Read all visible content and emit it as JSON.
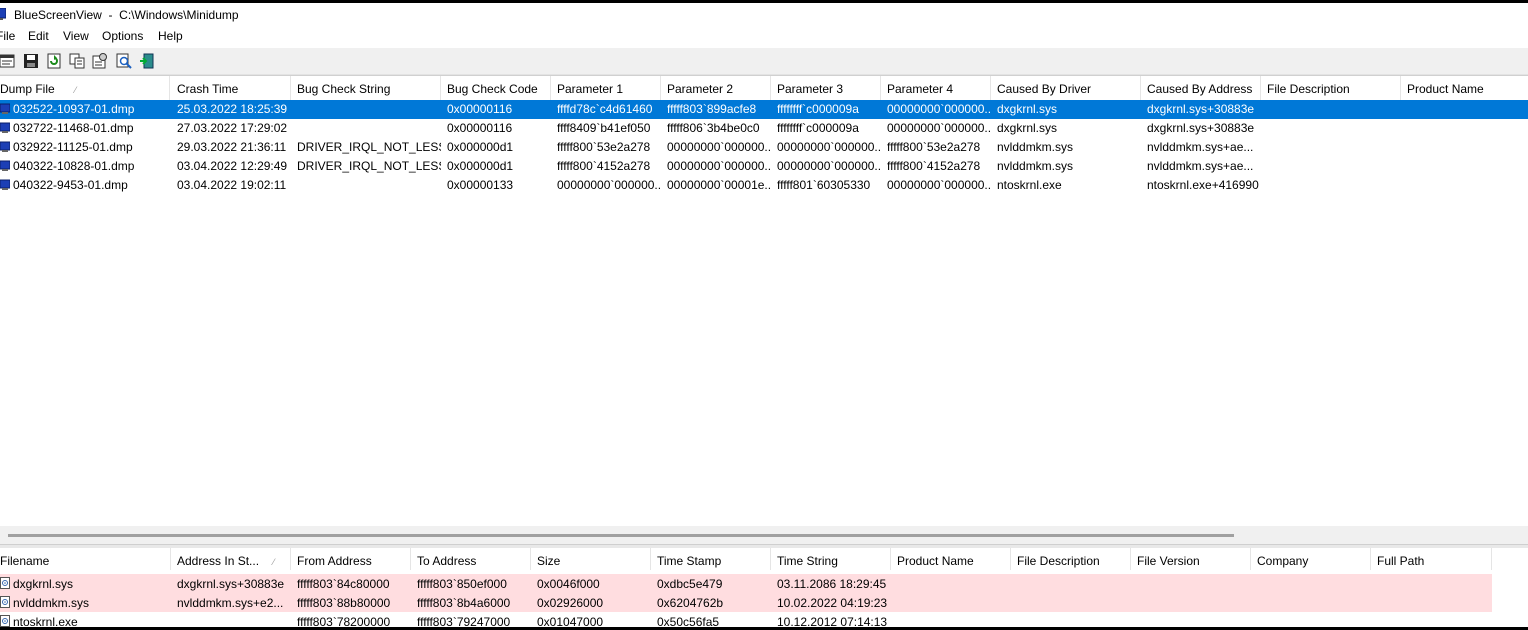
{
  "window": {
    "title": "BlueScreenView  -  C:\\Windows\\Minidump"
  },
  "menu": [
    "File",
    "Edit",
    "View",
    "Options",
    "Help"
  ],
  "toolbar": {
    "buttons": [
      "properties-icon",
      "save-icon",
      "refresh-icon",
      "copy-icon",
      "advanced-options-icon",
      "find-icon",
      "exit-icon"
    ]
  },
  "upper": {
    "columns": [
      "Dump File",
      "Crash Time",
      "Bug Check String",
      "Bug Check Code",
      "Parameter 1",
      "Parameter 2",
      "Parameter 3",
      "Parameter 4",
      "Caused By Driver",
      "Caused By Address",
      "File Description",
      "Product Name"
    ],
    "sort_indicator": "⁄",
    "rows": [
      [
        "032522-10937-01.dmp",
        "25.03.2022 18:25:39",
        "",
        "0x00000116",
        "ffffd78c`c4d61460",
        "fffff803`899acfe8",
        "ffffffff`c000009a",
        "00000000`000000...",
        "dxgkrnl.sys",
        "dxgkrnl.sys+30883e",
        "",
        ""
      ],
      [
        "032722-11468-01.dmp",
        "27.03.2022 17:29:02",
        "",
        "0x00000116",
        "ffff8409`b41ef050",
        "fffff806`3b4be0c0",
        "ffffffff`c000009a",
        "00000000`000000...",
        "dxgkrnl.sys",
        "dxgkrnl.sys+30883e",
        "",
        ""
      ],
      [
        "032922-11125-01.dmp",
        "29.03.2022 21:36:11",
        "DRIVER_IRQL_NOT_LESS...",
        "0x000000d1",
        "fffff800`53e2a278",
        "00000000`000000...",
        "00000000`000000...",
        "fffff800`53e2a278",
        "nvlddmkm.sys",
        "nvlddmkm.sys+ae...",
        "",
        ""
      ],
      [
        "040322-10828-01.dmp",
        "03.04.2022 12:29:49",
        "DRIVER_IRQL_NOT_LESS...",
        "0x000000d1",
        "fffff800`4152a278",
        "00000000`000000...",
        "00000000`000000...",
        "fffff800`4152a278",
        "nvlddmkm.sys",
        "nvlddmkm.sys+ae...",
        "",
        ""
      ],
      [
        "040322-9453-01.dmp",
        "03.04.2022 19:02:11",
        "",
        "0x00000133",
        "00000000`000000...",
        "00000000`00001e...",
        "fffff801`60305330",
        "00000000`000000...",
        "ntoskrnl.exe",
        "ntoskrnl.exe+416990",
        "",
        ""
      ]
    ]
  },
  "lower": {
    "columns": [
      "Filename",
      "Address In St...",
      "From Address",
      "To Address",
      "Size",
      "Time Stamp",
      "Time String",
      "Product Name",
      "File Description",
      "File Version",
      "Company",
      "Full Path"
    ],
    "sort_indicator": "⁄",
    "rows": [
      [
        "dxgkrnl.sys",
        "dxgkrnl.sys+30883e",
        "fffff803`84c80000",
        "fffff803`850ef000",
        "0x0046f000",
        "0xdbc5e479",
        "03.11.2086 18:29:45",
        "",
        "",
        "",
        "",
        ""
      ],
      [
        "nvlddmkm.sys",
        "nvlddmkm.sys+e2...",
        "fffff803`88b80000",
        "fffff803`8b4a6000",
        "0x02926000",
        "0x6204762b",
        "10.02.2022 04:19:23",
        "",
        "",
        "",
        "",
        ""
      ],
      [
        "ntoskrnl.exe",
        "",
        "fffff803`78200000",
        "fffff803`79247000",
        "0x01047000",
        "0x50c56fa5",
        "10.12.2012 07:14:13",
        "",
        "",
        "",
        "",
        ""
      ]
    ]
  },
  "colors": {
    "selection": "#0078d7",
    "highlight_row": "#ffdde0"
  }
}
